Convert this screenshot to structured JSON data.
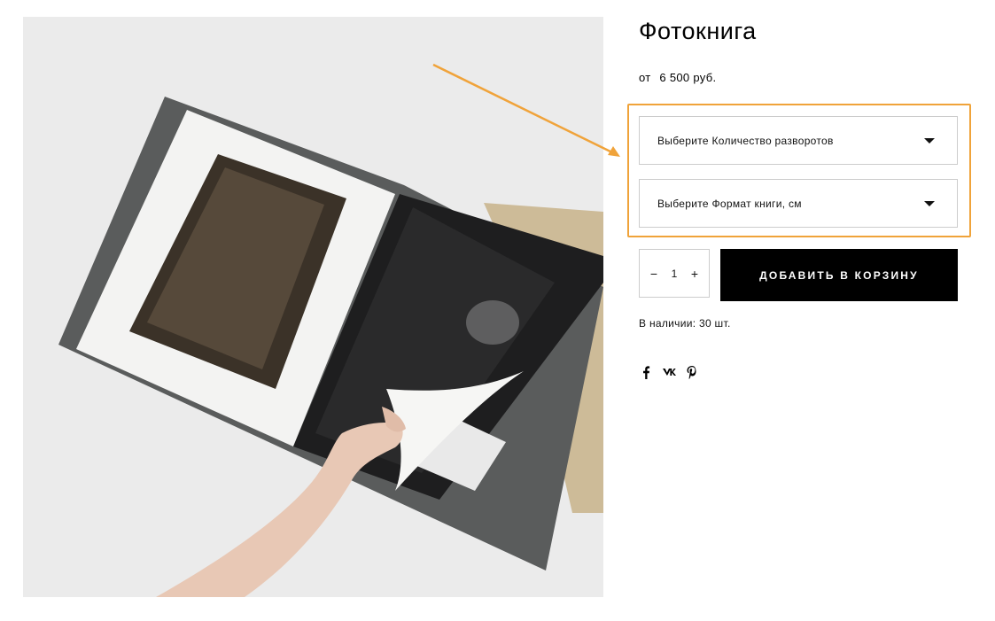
{
  "product": {
    "title": "Фотокнига",
    "price_prefix": "от",
    "price_value": "6 500 руб.",
    "image_alt": "photobook-product-image"
  },
  "options": [
    {
      "label": "Выберите Количество разворотов"
    },
    {
      "label": "Выберите Формат книги, см"
    }
  ],
  "quantity": {
    "minus": "−",
    "value": "1",
    "plus": "+"
  },
  "cart": {
    "button_label": "ДОБАВИТЬ В КОРЗИНУ"
  },
  "stock": {
    "text": "В наличии: 30 шт."
  },
  "share": [
    {
      "icon": "facebook-icon",
      "glyph": "f"
    },
    {
      "icon": "vk-icon",
      "glyph": "vk"
    },
    {
      "icon": "pinterest-icon",
      "glyph": "p"
    }
  ],
  "colors": {
    "highlight": "#f0a33a",
    "button_bg": "#000000",
    "border": "#cccccc"
  }
}
